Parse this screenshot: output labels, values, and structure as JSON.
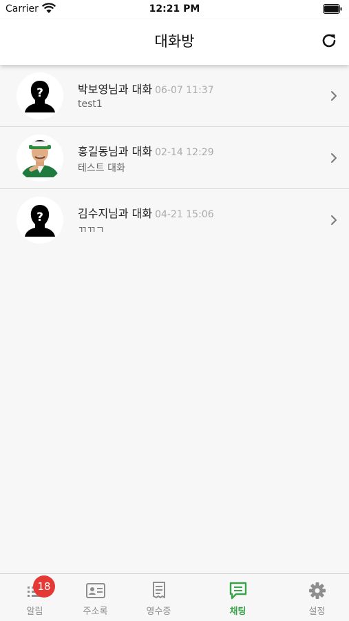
{
  "status_bar": {
    "carrier": "Carrier",
    "time": "12:21 PM"
  },
  "header": {
    "title": "대화방",
    "refresh_icon": "refresh-icon"
  },
  "chats": [
    {
      "name": "박보영님과 대화",
      "time": "06-07 11:37",
      "preview": "test1",
      "avatar": "unknown-person-icon"
    },
    {
      "name": "홍길동님과 대화",
      "time": "02-14 12:29",
      "preview": "테스트 대화",
      "avatar": "profile-photo"
    },
    {
      "name": "김수지님과 대화",
      "time": "04-21 15:06",
      "preview": "ㄲㄲㄱ",
      "avatar": "unknown-person-icon"
    }
  ],
  "tabs": [
    {
      "label": "알림",
      "icon": "list-icon",
      "badge": "18"
    },
    {
      "label": "주소록",
      "icon": "contact-card-icon"
    },
    {
      "label": "영수증",
      "icon": "receipt-icon"
    },
    {
      "label": "채팅",
      "icon": "chat-icon",
      "active": true
    },
    {
      "label": "설정",
      "icon": "gear-icon"
    }
  ],
  "colors": {
    "accent": "#3aa34a",
    "badge": "#e53935",
    "background": "#f7f7f7"
  }
}
